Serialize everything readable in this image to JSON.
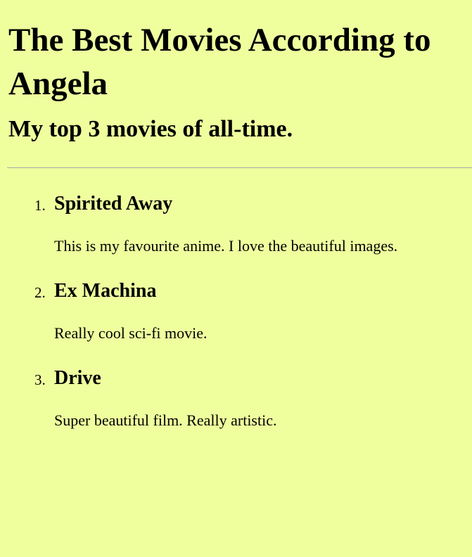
{
  "page": {
    "title": "The Best Movies According to Angela",
    "subtitle": "My top 3 movies of all-time."
  },
  "movies": [
    {
      "number": "1.",
      "title": "Spirited Away",
      "description": "This is my favourite anime. I love the beautiful images."
    },
    {
      "number": "2.",
      "title": "Ex Machina",
      "description": "Really cool sci-fi movie."
    },
    {
      "number": "3.",
      "title": "Drive",
      "description": "Super beautiful film. Really artistic."
    }
  ],
  "colors": {
    "background": "#efff9e",
    "divider": "#a8a8a8",
    "text": "#000000"
  }
}
